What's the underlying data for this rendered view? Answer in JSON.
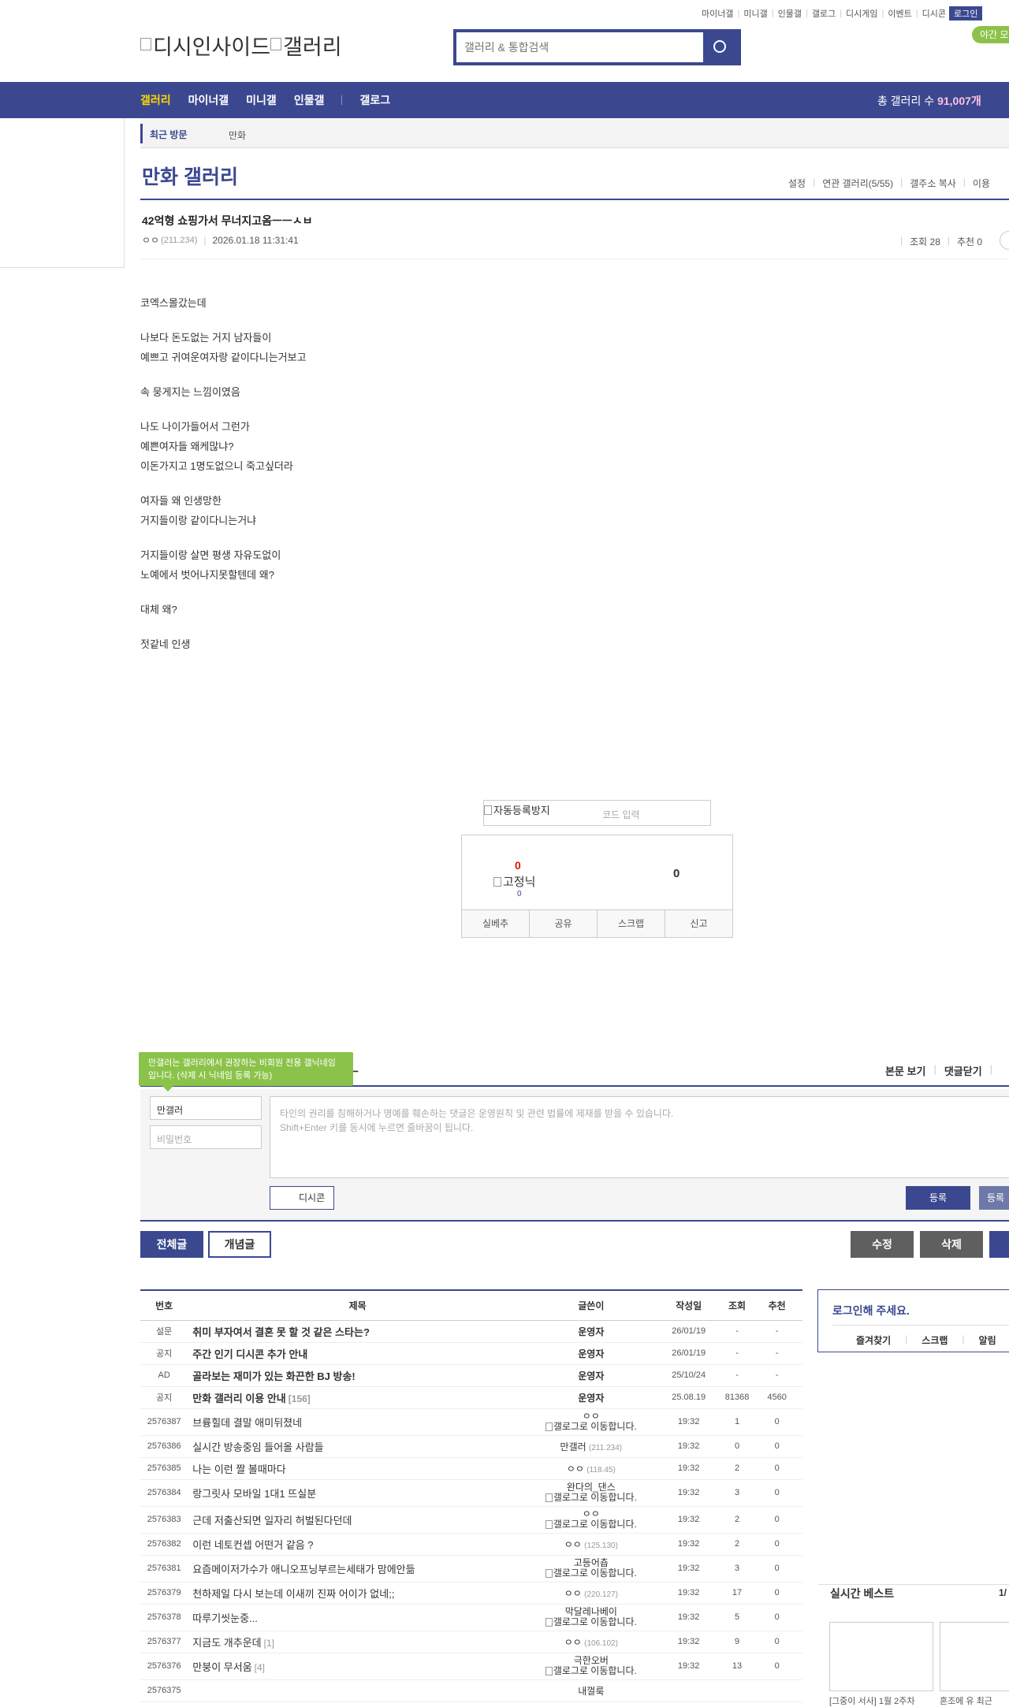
{
  "top_links": [
    "마이너갤",
    "미니갤",
    "인물갤",
    "갤로그",
    "디시게임",
    "이벤트",
    "디시콘"
  ],
  "login_label": "로그인",
  "night_label": "야간 모드",
  "logo_alt1": "디시인사이드",
  "logo_alt2": "갤러리",
  "search_placeholder": "갤러리 & 통합검색",
  "gnb": {
    "items": [
      "갤러리",
      "마이너갤",
      "미니갤",
      "인물갤",
      "갤로그"
    ],
    "total_label": "총 갤러리 수",
    "total_value": "91,007개"
  },
  "recent": {
    "label": "최근 방문",
    "item": "만화"
  },
  "gallery_title": "만화 갤러리",
  "gallery_options": [
    "설정",
    "연관 갤러리(5/55)",
    "갤주소 복사",
    "이용"
  ],
  "post": {
    "title": "42억형 쇼핑가서 무너지고옴ㅡㅡㅅㅂ",
    "author": "ㅇㅇ",
    "ip": "(211.234)",
    "date": "2026.01.18 11:31:41",
    "views": "조회 28",
    "recommend": "추천 0"
  },
  "body": [
    [
      "코엑스몰갔는데"
    ],
    [
      "나보다 돈도없는 거지 남자들이",
      "예쁘고 귀여운여자랑 같이다니는거보고"
    ],
    [
      "속 뭉게지는 느낌이였음"
    ],
    [
      "나도 나이가들어서 그런가",
      "예쁜여자들 왜케많냐?",
      "이돈가지고 1명도없으니 죽고싶더라"
    ],
    [
      "여자들 왜 인생망한",
      "거지들이랑 같이다니는거냐"
    ],
    [
      "거지들이랑 살면 평생 자유도없이",
      "노예에서 벗어나지못할텐데 왜?"
    ],
    [
      "대체 왜?"
    ],
    [
      "젓같네 인생"
    ]
  ],
  "captcha": {
    "alt": "자동등록방지",
    "placeholder": "코드 입력"
  },
  "recommend_box": {
    "up": "0",
    "fix_alt": "고정닉",
    "up_sub": "0",
    "down": "0",
    "buttons": [
      "실베추",
      "공유",
      "스크랩",
      "신고"
    ]
  },
  "comment": {
    "tooltip": "만갤러는 갤러리에서 권장하는 비회원 전용 갤닉네임입니다. (삭제 시 닉네임 등록 가능)",
    "title_fragment": "ㄴ",
    "view_body": "본문 보기",
    "close": "댓글닫기",
    "name": "만갤러",
    "password": "비밀번호",
    "placeholder1": "타인의 권리를 침해하거나 명예를 훼손하는 댓글은 운영원칙 및 관련 법률에 제재를 받을 수 있습니다.",
    "placeholder2": "Shift+Enter 키를 동시에 누르면 줄바꿈이 됩니다.",
    "dccon": "디시콘",
    "submit": "등록",
    "submit2": "등록"
  },
  "list_tabs": [
    "전체글",
    "개념글"
  ],
  "post_buttons": [
    "수정",
    "삭제"
  ],
  "list": {
    "headers": [
      "번호",
      "제목",
      "글쓴이",
      "작성일",
      "조회",
      "추천"
    ],
    "notices": [
      {
        "num": "설문",
        "title": "취미 부자여서 결혼 못 할 것 같은 스타는?",
        "writer": "운영자",
        "date": "26/01/19",
        "views": "-",
        "rec": "-"
      },
      {
        "num": "공지",
        "title": "주간 인기 디시콘 추가 안내",
        "writer": "운영자",
        "date": "26/01/19",
        "views": "-",
        "rec": "-"
      },
      {
        "num": "AD",
        "title": "골라보는 재미가 있는 화끈한 BJ 방송!",
        "writer": "운영자",
        "date": "25/10/24",
        "views": "-",
        "rec": "-"
      },
      {
        "num": "공지",
        "title": "만화 갤러리 이용 안내",
        "count": "[156]",
        "writer": "운영자",
        "date": "25.08.19",
        "views": "81368",
        "rec": "4560"
      }
    ],
    "rows": [
      {
        "num": "2576387",
        "title": "브륭힐데 결말 애미뒤졌네",
        "writer": "ㅇㅇ",
        "writer2": "갤로그로 이동합니다.",
        "date": "19:32",
        "views": "1",
        "rec": "0"
      },
      {
        "num": "2576386",
        "title": "실시간 방송중임 들어올 사람들",
        "writer": "만갤러",
        "ip": "(211.234)",
        "date": "19:32",
        "views": "0",
        "rec": "0"
      },
      {
        "num": "2576385",
        "title": "나는 이런 짤 볼때마다",
        "writer": "ㅇㅇ",
        "ip": "(118.45)",
        "date": "19:32",
        "views": "2",
        "rec": "0"
      },
      {
        "num": "2576384",
        "title": "랑그릿사 모바일 1대1 뜨실분",
        "writer": "완다의_댄스",
        "writer2": "갤로그로 이동합니다.",
        "date": "19:32",
        "views": "3",
        "rec": "0"
      },
      {
        "num": "2576383",
        "title": "근데 저출산되면 일자리 허벌된다던데",
        "writer": "ㅇㅇ",
        "writer2": "갤로그로 이동합니다.",
        "date": "19:32",
        "views": "2",
        "rec": "0"
      },
      {
        "num": "2576382",
        "title": "이런 네토컨셉 어떤거 같음 ?",
        "writer": "ㅇㅇ",
        "ip": "(125.130)",
        "date": "19:32",
        "views": "2",
        "rec": "0"
      },
      {
        "num": "2576381",
        "title": "요즘메이저가수가 애니오프닝부르는세태가 맘에안듦",
        "writer": "고등어춉",
        "writer2": "갤로그로 이동합니다.",
        "date": "19:32",
        "views": "3",
        "rec": "0"
      },
      {
        "num": "2576379",
        "title": "천하제일 다시 보는데 이새끼 진짜 어이가 없네;;",
        "writer": "ㅇㅇ",
        "ip": "(220.127)",
        "date": "19:32",
        "views": "17",
        "rec": "0"
      },
      {
        "num": "2576378",
        "title": "따루기씻눈중...",
        "writer": "막달레나베이",
        "writer2": "갤로그로 이동합니다.",
        "date": "19:32",
        "views": "5",
        "rec": "0"
      },
      {
        "num": "2576377",
        "title": "지금도 개추운데",
        "count": "[1]",
        "writer": "ㅇㅇ",
        "ip": "(106.102)",
        "date": "19:32",
        "views": "9",
        "rec": "0"
      },
      {
        "num": "2576376",
        "title": "만붕이 무서움",
        "count": "[4]",
        "writer": "극한오버",
        "writer2": "갤로그로 이동합니다.",
        "date": "19:32",
        "views": "13",
        "rec": "0"
      },
      {
        "num": "2576375",
        "title": "",
        "writer": "내껄룩",
        "date": "",
        "views": "",
        "rec": ""
      }
    ]
  },
  "side": {
    "login_prompt": "로그인해 주세요.",
    "links": [
      "즐겨찾기",
      "스크랩",
      "알림"
    ]
  },
  "best": {
    "title": "실시간 베스트",
    "page": "1/",
    "captions": [
      "[그중이 서사] 1월 2주차",
      "혼조에 유 최근"
    ]
  }
}
